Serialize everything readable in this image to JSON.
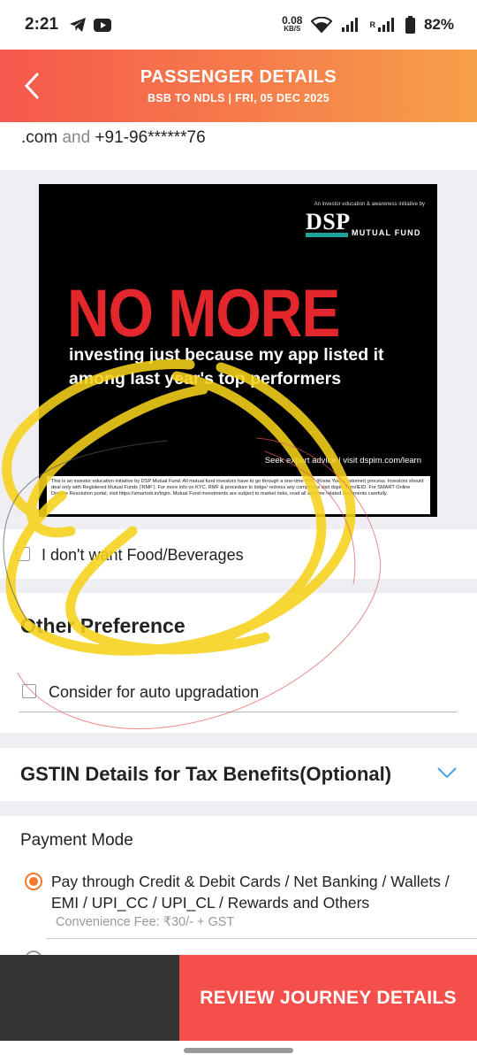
{
  "status_bar": {
    "time": "2:21",
    "net_speed_value": "0.08",
    "net_speed_unit": "KB/S",
    "roaming": "R",
    "battery": "82%",
    "left_icons": [
      "telegram-icon",
      "youtube-icon"
    ]
  },
  "header": {
    "title": "PASSENGER DETAILS",
    "subtitle": "BSB TO NDLS |  FRI, 05 DEC  2025",
    "gradient": [
      "#f5584c",
      "#f7a04a"
    ]
  },
  "contact": {
    "email_suffix": ".com",
    "and_word": "and",
    "phone": "+91-96******76"
  },
  "ad": {
    "top_tag": "An investor education & awareness initiative by",
    "brand": "DSP",
    "brand_sub": "MUTUAL FUND",
    "headline": "NO MORE",
    "body": "investing just because my app listed it among last year's top performers",
    "advice": "Seek expert advice | visit dspim.com/learn",
    "disclaimer": "This is an investor education initiative by DSP Mutual Fund. All mutual fund investors have to go through a one-time KYC (Know Your Customer) process. Investors should deal only with Registered Mutual Funds ('RMF'). For more info on KYC, RMF & procedure to lodge/ redress any complaints visit dspim.com/IEID. For SMART Online Dispute Resolution portal, visit https://smartodr.in/login. Mutual Fund investments are subject to market risks, read all scheme related documents carefully.",
    "headline_color": "#e4262d"
  },
  "food": {
    "label": "I don't want Food/Beverages",
    "checked": false
  },
  "other_preference": {
    "title": "Other Preference",
    "upgrade_label": "Consider for auto upgradation",
    "checked": false
  },
  "gstin": {
    "title": "GSTIN Details for Tax Benefits(Optional)"
  },
  "payment": {
    "title": "Payment Mode",
    "option_label": "Pay through Credit & Debit Cards / Net Banking / Wallets / EMI / UPI_CC / UPI_CL / Rewards and Others",
    "fee": "Convenience Fee: ₹30/- + GST",
    "accent": "#f27a2b"
  },
  "footer": {
    "review_button": "REVIEW JOURNEY DETAILS",
    "button_color": "#f44f4a"
  }
}
